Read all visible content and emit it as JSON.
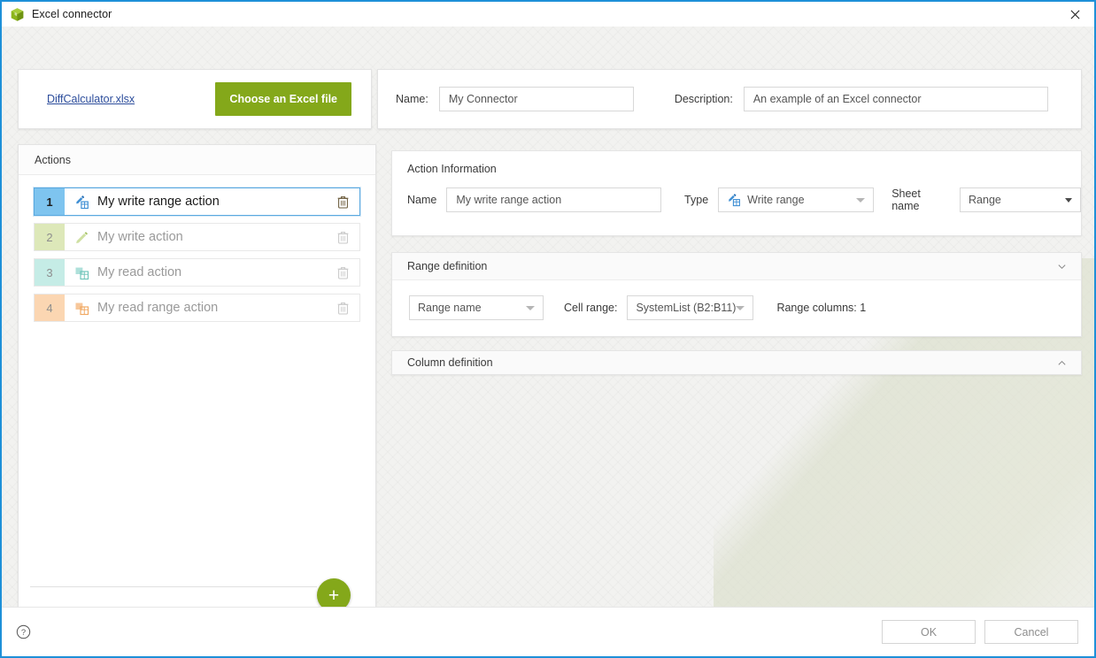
{
  "window": {
    "title": "Excel connector",
    "app_icon": "excel-cube-icon",
    "close_label": "✕",
    "accent_border": "#1e90d8"
  },
  "file_card": {
    "file_name": "DiffCalculator.xlsx",
    "choose_button_label": "Choose an Excel file",
    "button_color": "#84a81a"
  },
  "meta": {
    "name_label": "Name:",
    "name_value": "My Connector",
    "description_label": "Description:",
    "description_value": "An example of an Excel connector"
  },
  "actions_panel": {
    "header": "Actions",
    "add_button_label": "+",
    "items": [
      {
        "number": "1",
        "label": "My write range action",
        "icon": "write-range-icon",
        "badge_color": "#7ec4ef",
        "number_color": "#1d1d1d",
        "selected": true
      },
      {
        "number": "2",
        "label": "My write action",
        "icon": "write-icon",
        "badge_color": "#dde8b9",
        "number_color": "#8e8e8e",
        "selected": false
      },
      {
        "number": "3",
        "label": "My read action",
        "icon": "read-icon",
        "badge_color": "#c5ece6",
        "number_color": "#8e8e8e",
        "selected": false
      },
      {
        "number": "4",
        "label": "My read range action",
        "icon": "read-range-icon",
        "badge_color": "#fbd6b2",
        "number_color": "#8e8e8e",
        "selected": false
      }
    ]
  },
  "action_information": {
    "title": "Action Information",
    "name_label": "Name",
    "name_value": "My write range action",
    "type_label": "Type",
    "type_value": "Write range",
    "type_icon": "write-range-icon",
    "sheet_name_label": "Sheet name",
    "sheet_name_value": "Range"
  },
  "range_definition": {
    "title": "Range definition",
    "expanded": true,
    "chevron": "chevron-down-icon",
    "range_mode_value": "Range name",
    "cell_range_label": "Cell range:",
    "cell_range_value": "SystemList (B2:B11)",
    "range_columns_text": "Range columns: 1"
  },
  "column_definition": {
    "title": "Column definition",
    "expanded": false,
    "chevron": "chevron-up-icon"
  },
  "footer": {
    "help_icon": "help-circle-icon",
    "ok_label": "OK",
    "cancel_label": "Cancel"
  }
}
